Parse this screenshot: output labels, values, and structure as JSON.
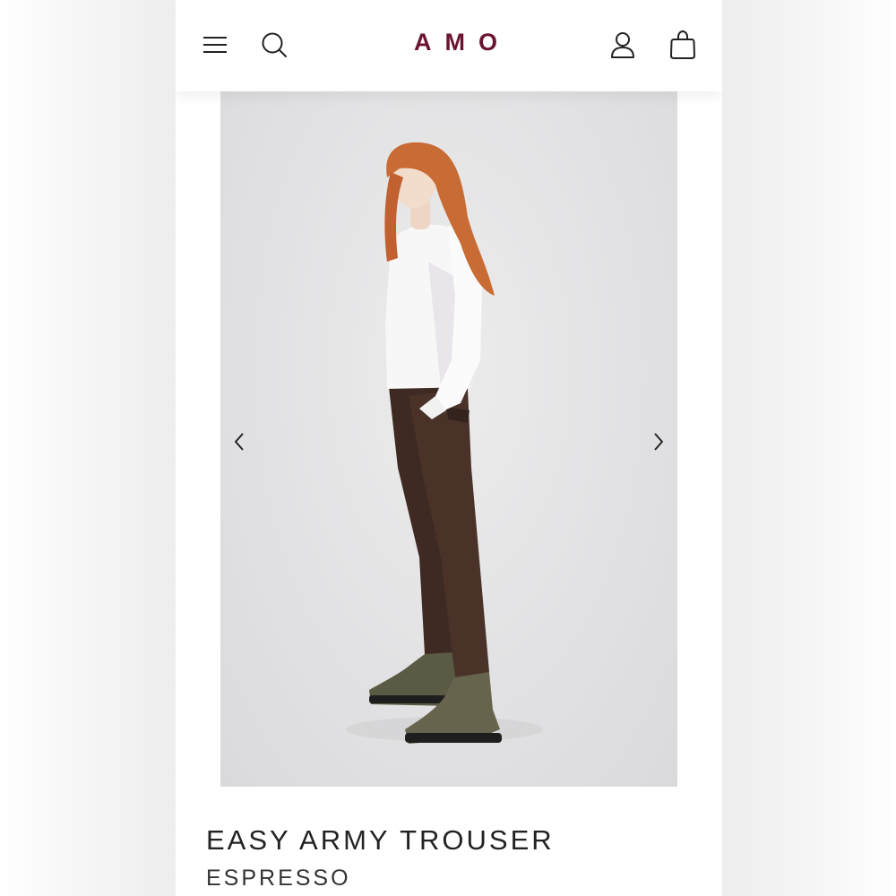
{
  "header": {
    "logo": "AMO",
    "logo_color": "#6a1530",
    "icons": {
      "menu": "hamburger-menu-icon",
      "search": "search-icon",
      "account": "user-icon",
      "cart": "shopping-bag-icon"
    }
  },
  "gallery": {
    "image_description": "model wearing white long-sleeve top, dark brown trousers and olive suede boots",
    "prev_icon": "chevron-left-icon",
    "next_icon": "chevron-right-icon"
  },
  "product": {
    "name": "EASY ARMY TROUSER",
    "color": "ESPRESSO"
  }
}
